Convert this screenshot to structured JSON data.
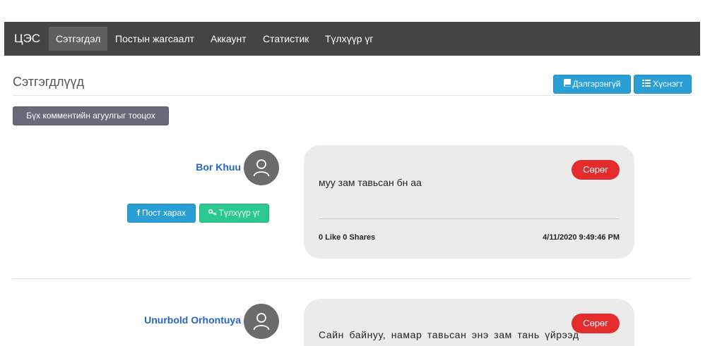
{
  "nav": {
    "brand": "ЦЭС",
    "items": [
      {
        "label": "Сэтгэгдэл",
        "active": true
      },
      {
        "label": "Постын жагсаалт",
        "active": false
      },
      {
        "label": "Аккаунт",
        "active": false
      },
      {
        "label": "Статистик",
        "active": false
      },
      {
        "label": "Түлхүүр үг",
        "active": false
      }
    ]
  },
  "header": {
    "title": "Сэтгэгдлүүд",
    "details_label": "Дэлгэрэнгүй",
    "table_label": "Хүснэгт"
  },
  "toolbar": {
    "count_label": "Бүх комментийн агуулгыг тооцох"
  },
  "comments": [
    {
      "author": "Bor Khuu",
      "view_post_label": "Пост харах",
      "keyword_label": "Түлхүүр үг",
      "sentiment": "Сөрөг",
      "text": "муу зам тавьсан бн аа",
      "stats": "0 Like 0 Shares",
      "timestamp": "4/11/2020 9:49:46 PM"
    },
    {
      "author": "Unurbold Orhontuya",
      "sentiment": "Сөрөг",
      "text": "Сайн байнуу, намар тавьсан энэ зам тань үйрээд"
    }
  ],
  "colors": {
    "navbar": "#444444",
    "primary": "#2a9fd6",
    "success": "#2bc88f",
    "danger": "#e42c2c",
    "link": "#2566c4",
    "bubble": "#ebebeb"
  },
  "icons": {
    "details": "book-icon",
    "table": "list-icon",
    "view_post": "facebook-icon",
    "keyword": "key-icon",
    "avatar": "user-icon"
  }
}
